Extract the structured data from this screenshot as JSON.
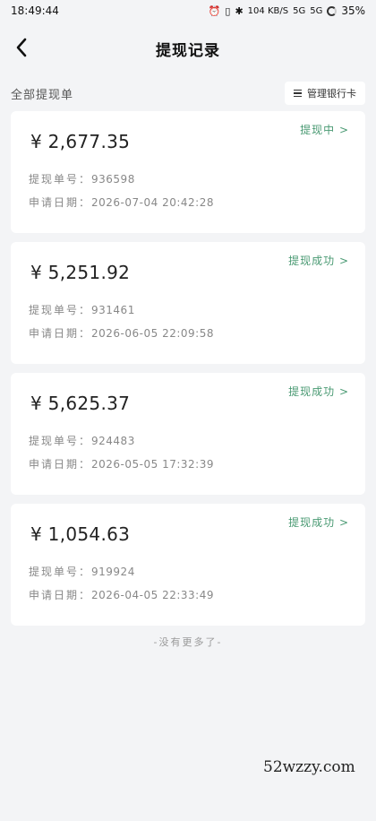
{
  "status_bar": {
    "time": "18:49:44",
    "net_speed": "104 KB/S",
    "signal1": "5G",
    "signal2": "5G",
    "battery": "35%"
  },
  "header": {
    "title": "提现记录"
  },
  "filter": {
    "label": "全部提现单",
    "manage_label": "管理银行卡"
  },
  "records": [
    {
      "amount": "¥ 2,677.35",
      "status": "提现中 >",
      "no_label": "提现单号：",
      "no": "936598",
      "date_label": "申请日期：",
      "date": "2026-07-04 20:42:28",
      "status_color": "#4a9a73"
    },
    {
      "amount": "¥ 5,251.92",
      "status": "提现成功 >",
      "no_label": "提现单号：",
      "no": "931461",
      "date_label": "申请日期：",
      "date": "2026-06-05 22:09:58",
      "status_color": "#4a9a73"
    },
    {
      "amount": "¥ 5,625.37",
      "status": "提现成功 >",
      "no_label": "提现单号：",
      "no": "924483",
      "date_label": "申请日期：",
      "date": "2026-05-05 17:32:39",
      "status_color": "#4a9a73"
    },
    {
      "amount": "¥ 1,054.63",
      "status": "提现成功 >",
      "no_label": "提现单号：",
      "no": "919924",
      "date_label": "申请日期：",
      "date": "2026-04-05 22:33:49",
      "status_color": "#4a9a73"
    }
  ],
  "end_note": "-没有更多了-",
  "watermark": "52wzzy.com"
}
